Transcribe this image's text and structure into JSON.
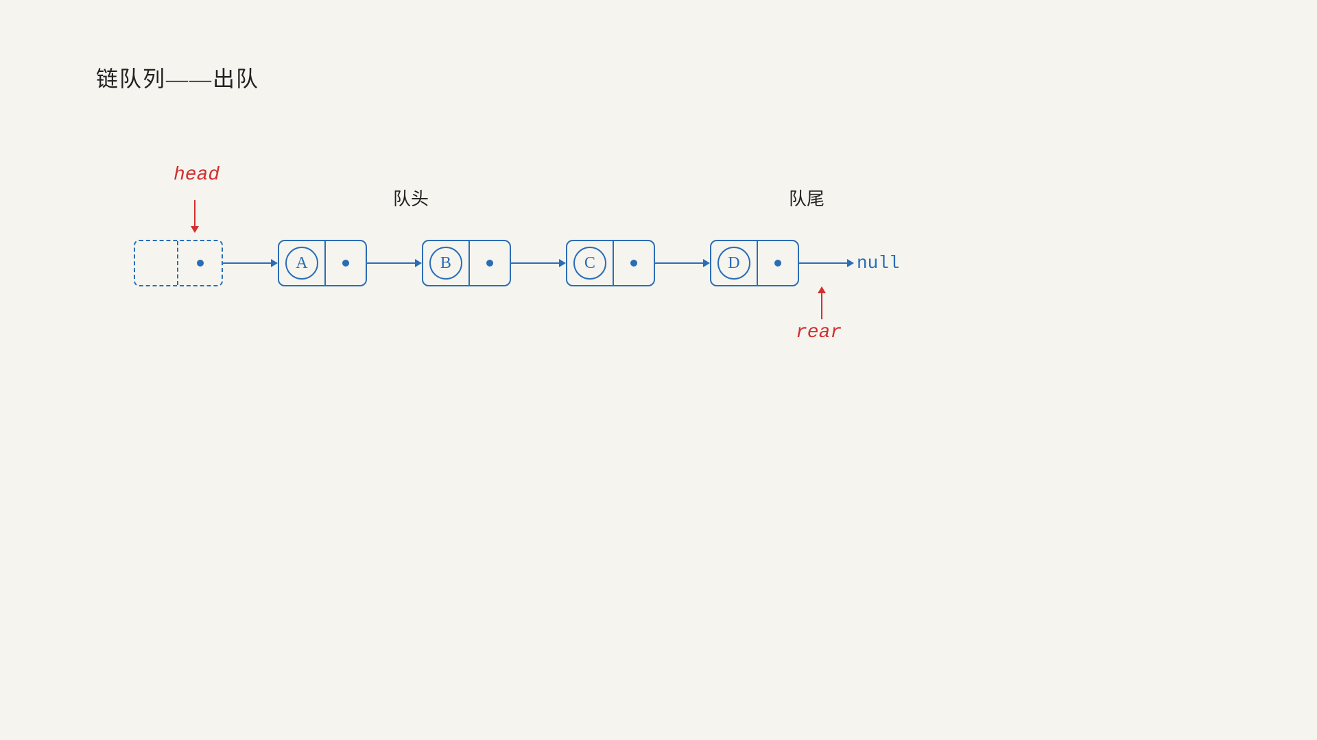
{
  "title": "链队列——出队",
  "diagram": {
    "head_label": "head",
    "queue_head_label": "队头",
    "queue_tail_label": "队尾",
    "rear_label": "rear",
    "null_label": "null",
    "nodes": [
      {
        "id": "dummy",
        "type": "dummy",
        "value": ""
      },
      {
        "id": "A",
        "type": "data",
        "value": "A"
      },
      {
        "id": "B",
        "type": "data",
        "value": "B"
      },
      {
        "id": "C",
        "type": "data",
        "value": "C"
      },
      {
        "id": "D",
        "type": "data",
        "value": "D"
      }
    ],
    "colors": {
      "blue": "#2a6db5",
      "red": "#d32f2f",
      "background": "#f5f4ef"
    }
  }
}
